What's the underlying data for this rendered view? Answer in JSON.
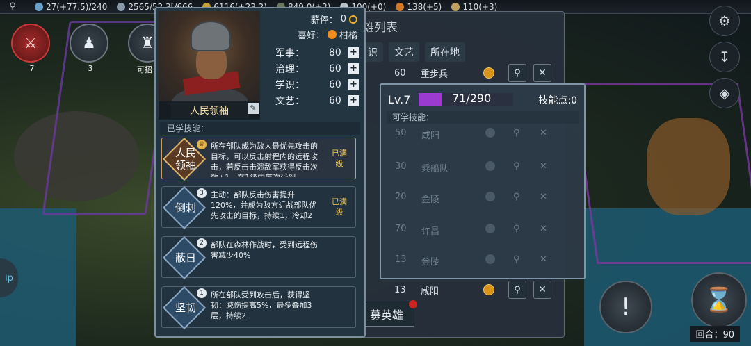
{
  "topbar": {
    "resource1": "27(+77.5)/240",
    "resource2": "2565/52.3[/666",
    "resource3": "6116(+23.2)",
    "resource4": "849.0(+2)",
    "resource5": "100(+0)",
    "resource6": "138(+5)",
    "resource7": "110(+3)"
  },
  "left_buttons": {
    "btn1_label": "7",
    "btn2_label": "3",
    "btn3_label": "可招"
  },
  "hero_list": {
    "title": "雄列表",
    "tabs": [
      "识",
      "文艺",
      "所在地"
    ],
    "rows": [
      {
        "num": "60",
        "place": "重步兵"
      },
      {
        "num": "50",
        "place": "咸阳"
      },
      {
        "num": "30",
        "place": "乘船队"
      },
      {
        "num": "20",
        "place": "金陵"
      },
      {
        "num": "70",
        "place": "许昌"
      },
      {
        "num": "13",
        "place": "金陵"
      },
      {
        "num": "13",
        "place": "咸阳"
      }
    ],
    "recruit_label": "募英雄"
  },
  "hero": {
    "name": "人民领袖",
    "salary_label": "薪俸：",
    "salary_value": "0",
    "like_label": "喜好：",
    "like_value": "柑橘",
    "stats": [
      {
        "label": "军事：",
        "value": "80"
      },
      {
        "label": "治理：",
        "value": "60"
      },
      {
        "label": "学识：",
        "value": "60"
      },
      {
        "label": "文艺：",
        "value": "60"
      }
    ],
    "learned_label": "已学技能：",
    "skills": [
      {
        "name": "人民\n领袖",
        "level": "",
        "desc": "所在部队成为敌人最优先攻击的目标，可以反击射程内的远程攻击，若反击击溃敌军获得反击次数+1，在1级中每次受到",
        "status": "已满级"
      },
      {
        "name": "倒刺",
        "level": "3",
        "desc": "主动：部队反击伤害提升120%，并成为敌方近战部队优先攻击的目标，持续1，冷却2",
        "status": "已满级"
      },
      {
        "name": "蔽日",
        "level": "2",
        "desc": "部队在森林作战时，受到远程伤害减少40%",
        "status": ""
      },
      {
        "name": "坚韧",
        "level": "1",
        "desc": "所在部队受到攻击后，获得坚韧：减伤提高5%，最多叠加3层，持续2",
        "status": ""
      }
    ]
  },
  "skill_points": {
    "level": "Lv.7",
    "xp_text": "71/290",
    "xp_fraction": 0.245,
    "points": "技能点:0",
    "learnable_label": "可学技能："
  },
  "bottom": {
    "turn_label": "回合：",
    "turn_value": "90"
  },
  "side": {
    "left_tab": "ip"
  }
}
